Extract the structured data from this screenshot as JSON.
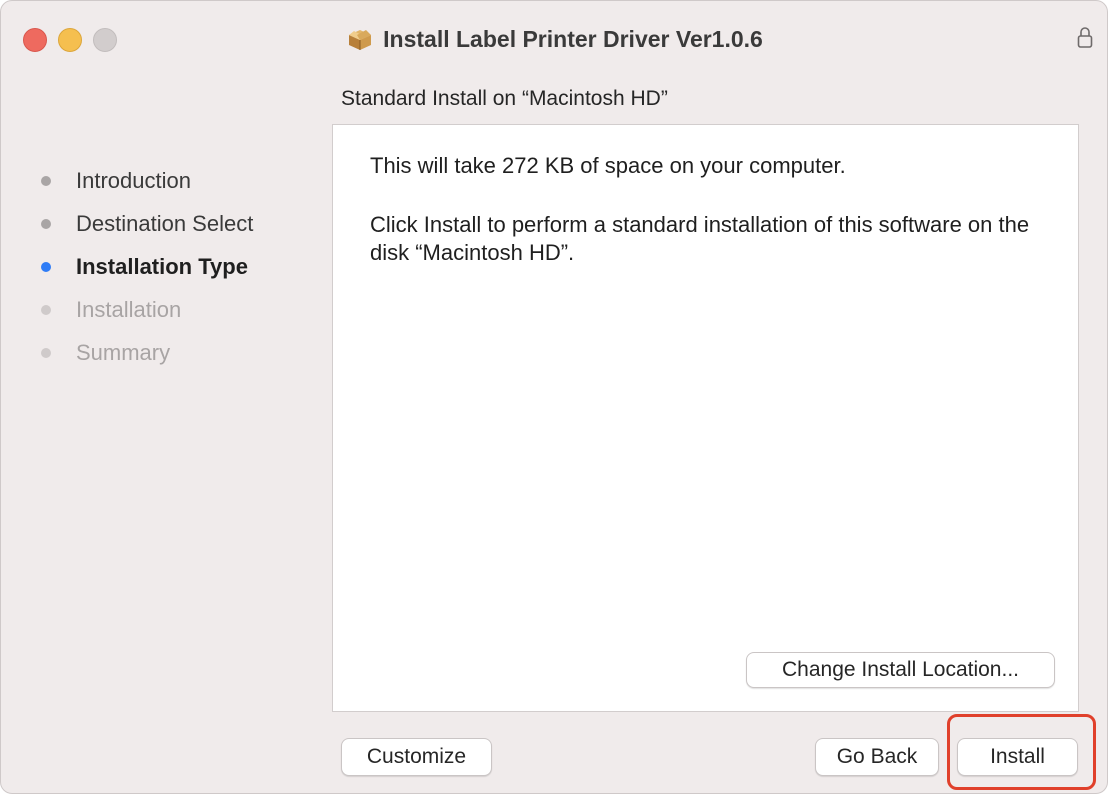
{
  "window": {
    "title": "Install Label Printer Driver Ver1.0.6",
    "title_icon": "package-box-icon",
    "lock_icon": "lock-icon"
  },
  "sidebar": {
    "steps": [
      {
        "label": "Introduction",
        "state": "done"
      },
      {
        "label": "Destination Select",
        "state": "done"
      },
      {
        "label": "Installation Type",
        "state": "current"
      },
      {
        "label": "Installation",
        "state": "future"
      },
      {
        "label": "Summary",
        "state": "future"
      }
    ]
  },
  "main": {
    "header": "Standard Install on “Macintosh HD”",
    "line1": "This will take 272 KB of space on your computer.",
    "line2": "Click Install to perform a standard installation of this software on the disk “Macintosh HD”.",
    "change_location_label": "Change Install Location..."
  },
  "footer": {
    "customize_label": "Customize",
    "go_back_label": "Go Back",
    "install_label": "Install"
  },
  "colors": {
    "current_step_dot": "#2f7cf6",
    "highlight": "#e0402b",
    "close": "#ee6a5f",
    "minimize": "#f5bf4f",
    "zoom": "#d2cdcd"
  }
}
